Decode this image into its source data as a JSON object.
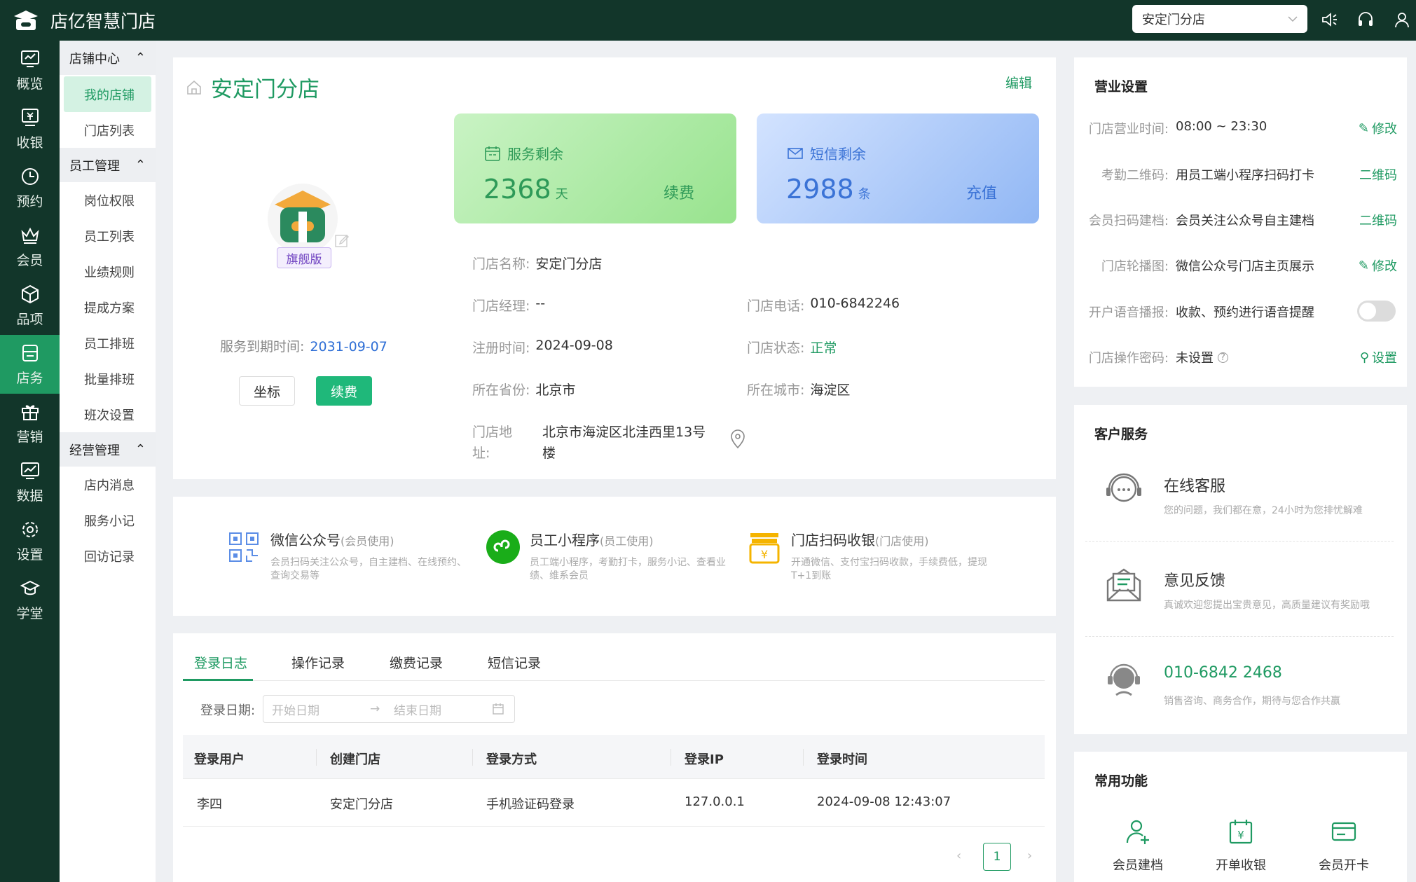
{
  "app": {
    "title": "店亿智慧门店"
  },
  "topbar": {
    "store_select": "安定门分店"
  },
  "leftnav": [
    "概览",
    "收银",
    "预约",
    "会员",
    "品项",
    "店务",
    "营销",
    "数据",
    "设置",
    "学堂"
  ],
  "subnav": {
    "groups": [
      {
        "label": "店铺中心",
        "items": [
          "我的店铺",
          "门店列表"
        ]
      },
      {
        "label": "员工管理",
        "items": [
          "岗位权限",
          "员工列表",
          "业绩规则",
          "提成方案",
          "员工排班",
          "批量排班",
          "班次设置"
        ]
      },
      {
        "label": "经营管理",
        "items": [
          "店内消息",
          "服务小记",
          "回访记录"
        ]
      }
    ]
  },
  "store": {
    "title": "安定门分店",
    "edit": "编辑",
    "badge": "旗舰版",
    "expire_label": "服务到期时间:",
    "expire_value": "2031-09-07",
    "btn_coord": "坐标",
    "btn_renew": "续费",
    "service": {
      "label": "服务剩余",
      "value": "2368",
      "unit": "天",
      "action": "续费"
    },
    "sms": {
      "label": "短信剩余",
      "value": "2988",
      "unit": "条",
      "action": "充值"
    },
    "info": {
      "name_k": "门店名称:",
      "name_v": "安定门分店",
      "manager_k": "门店经理:",
      "manager_v": "--",
      "phone_k": "门店电话:",
      "phone_v": "010-6842246",
      "reg_k": "注册时间:",
      "reg_v": "2024-09-08",
      "status_k": "门店状态:",
      "status_v": "正常",
      "prov_k": "所在省份:",
      "prov_v": "北京市",
      "city_k": "所在城市:",
      "city_v": "海淀区",
      "addr_k1": "门店地",
      "addr_k2": "址:",
      "addr_v1": "北京市海淀区北洼西里13号",
      "addr_v2": "楼"
    }
  },
  "apps": [
    {
      "title": "微信公众号",
      "sub": "(会员使用)",
      "d1": "会员扫码关注公众号，自主建档、在线预约、",
      "d2": "查询交易等"
    },
    {
      "title": "员工小程序",
      "sub": "(员工使用)",
      "d1": "员工端小程序，考勤打卡，服务小记、查看业",
      "d2": "绩、维系会员"
    },
    {
      "title": "门店扫码收银",
      "sub": "(门店使用)",
      "d1": "开通微信、支付宝扫码收款，手续费低，提现",
      "d2": "T+1到账"
    }
  ],
  "logs": {
    "tabs": [
      "登录日志",
      "操作记录",
      "缴费记录",
      "短信记录"
    ],
    "date_label": "登录日期:",
    "start_placeholder": "开始日期",
    "end_placeholder": "结束日期",
    "columns": [
      "登录用户",
      "创建门店",
      "登录方式",
      "登录IP",
      "登录时间"
    ],
    "rows": [
      [
        "李四",
        "安定门分店",
        "手机验证码登录",
        "127.0.0.1",
        "2024-09-08 12:43:07"
      ]
    ],
    "page": "1"
  },
  "settings": {
    "title": "营业设置",
    "rows": [
      {
        "k": "门店营业时间:",
        "v": "08:00 ~ 23:30",
        "a": "修改"
      },
      {
        "k": "考勤二维码:",
        "v": "用员工端小程序扫码打卡",
        "a": "二维码"
      },
      {
        "k": "会员扫码建档:",
        "v": "会员关注公众号自主建档",
        "a": "二维码"
      },
      {
        "k": "门店轮播图:",
        "v": "微信公众号门店主页展示",
        "a": "修改"
      },
      {
        "k": "开户语音播报:",
        "v": "收款、预约进行语音提醒",
        "a": ""
      },
      {
        "k": "门店操作密码:",
        "v": "未设置",
        "a": "设置"
      }
    ],
    "voice_toggle": "off"
  },
  "service": {
    "title": "客户服务",
    "items": [
      {
        "t": "在线客服",
        "d": "您的问题，我们都在意，24小时为您排忧解难"
      },
      {
        "t": "意见反馈",
        "d": "真诚欢迎您提出宝贵意见，高质量建议有奖励哦"
      },
      {
        "t": "010-6842 2468",
        "d": "销售咨询、商务合作，期待与您合作共赢"
      }
    ]
  },
  "common": {
    "title": "常用功能",
    "items": [
      "会员建档",
      "开单收银",
      "会员开卡"
    ]
  },
  "colors": {
    "brand": "#1f9a62",
    "dark": "#12362a",
    "link": "#2f6fd6"
  }
}
